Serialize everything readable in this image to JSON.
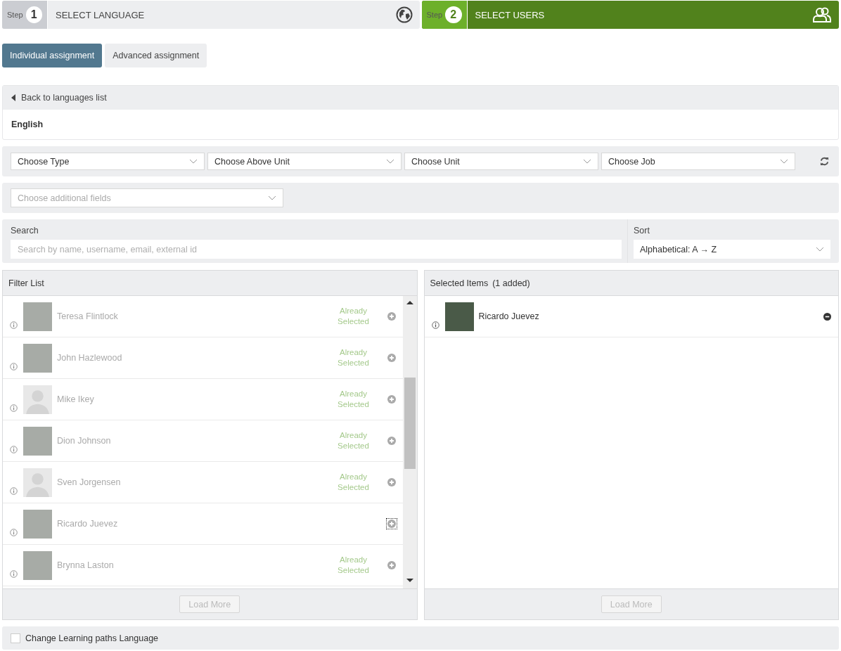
{
  "steps": [
    {
      "label": "Step",
      "number": "1",
      "title": "SELECT LANGUAGE",
      "active": false
    },
    {
      "label": "Step",
      "number": "2",
      "title": "SELECT USERS",
      "active": true
    }
  ],
  "tabs": [
    {
      "label": "Individual assignment",
      "selected": true
    },
    {
      "label": "Advanced assignment",
      "selected": false
    }
  ],
  "back_link": "Back to languages list",
  "language": "English",
  "filters": [
    {
      "placeholder": "Choose Type"
    },
    {
      "placeholder": "Choose Above Unit"
    },
    {
      "placeholder": "Choose Unit"
    },
    {
      "placeholder": "Choose Job"
    }
  ],
  "additional_fields": {
    "placeholder": "Choose additional fields"
  },
  "search": {
    "label": "Search",
    "placeholder": "Search by name, username, email, external id"
  },
  "sort": {
    "label": "Sort",
    "value": "Alphabetical: A → Z"
  },
  "filter_list": {
    "title": "Filter List",
    "load_more": "Load More",
    "rows": [
      {
        "name": "Teresa Flintlock",
        "kind": "photo",
        "status": "Already Selected",
        "focused": false
      },
      {
        "name": "John Hazlewood",
        "kind": "photo",
        "status": "Already Selected",
        "focused": false
      },
      {
        "name": "Mike Ikey",
        "kind": "silhouette",
        "status": "Already Selected",
        "focused": false
      },
      {
        "name": "Dion Johnson",
        "kind": "photo",
        "status": "Already Selected",
        "focused": false
      },
      {
        "name": "Sven Jorgensen",
        "kind": "silhouette",
        "status": "Already Selected",
        "focused": false
      },
      {
        "name": "Ricardo Juevez",
        "kind": "photo",
        "focused": true
      },
      {
        "name": "Brynna Laston",
        "kind": "photo",
        "status": "Already Selected",
        "focused": false
      }
    ]
  },
  "selected_items": {
    "title": "Selected Items",
    "count": "(1 added)",
    "load_more": "Load More",
    "rows": [
      {
        "name": "Ricardo Juevez",
        "kind": "photo"
      }
    ]
  },
  "change_paths": {
    "label": "Change Learning paths Language",
    "checked": false
  }
}
